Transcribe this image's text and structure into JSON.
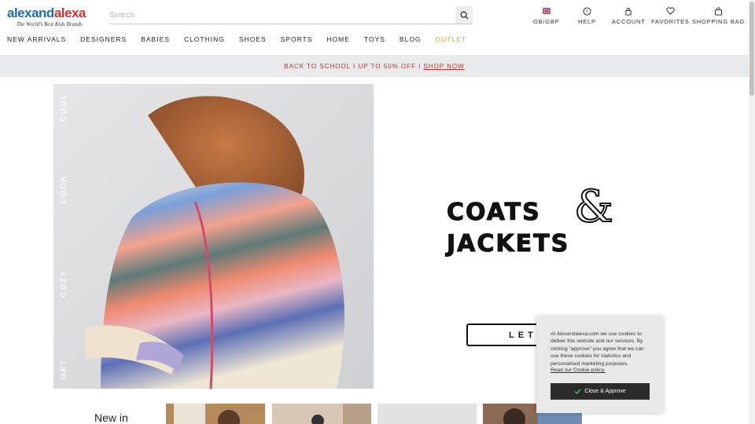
{
  "logo": {
    "part1": "alexand",
    "part2": "alexa",
    "tagline": "The World's Best Kids Brands"
  },
  "search": {
    "placeholder": "Search",
    "value": ""
  },
  "utility": {
    "locale": "GB/GBP",
    "help": "HELP",
    "account": "ACCOUNT",
    "favorites": "FAVORITES",
    "bag": "SHOPPING BAG"
  },
  "nav": {
    "items": [
      "NEW ARRIVALS",
      "DESIGNERS",
      "BABIES",
      "CLOTHING",
      "SHOES",
      "SPORTS",
      "HOME",
      "TOYS",
      "BLOG",
      "OUTLET"
    ]
  },
  "promo": {
    "text": "BACK TO SCHOOL I UP TO 50% OFF I",
    "link": "SHOP NOW"
  },
  "hero": {
    "side_words": [
      "COOL",
      "LOOK",
      "COZY",
      "GET"
    ],
    "title_line1": "COATS",
    "title_amp": "&",
    "title_line2": "JACKETS",
    "cta_label": "LET'"
  },
  "new_in": {
    "label": "New in"
  },
  "cookie": {
    "text": "At Alexandalexa.com we use cookies to deliver this website and our services. By clicking \"approve\" you agree that we can use these cookies for statistics and personalised marketing purposes.",
    "link": "Read our Cookie policy.",
    "button": "Close & Approve"
  },
  "colors": {
    "brand_blue": "#1f6fb7",
    "brand_red": "#d6322f",
    "outlet": "#e8a020",
    "promo_text": "#b8342e",
    "promo_bg": "#e8eaec"
  },
  "icons": [
    "flag-uk-icon",
    "help-icon",
    "lock-icon",
    "heart-icon",
    "bag-icon",
    "search-icon",
    "check-icon"
  ]
}
